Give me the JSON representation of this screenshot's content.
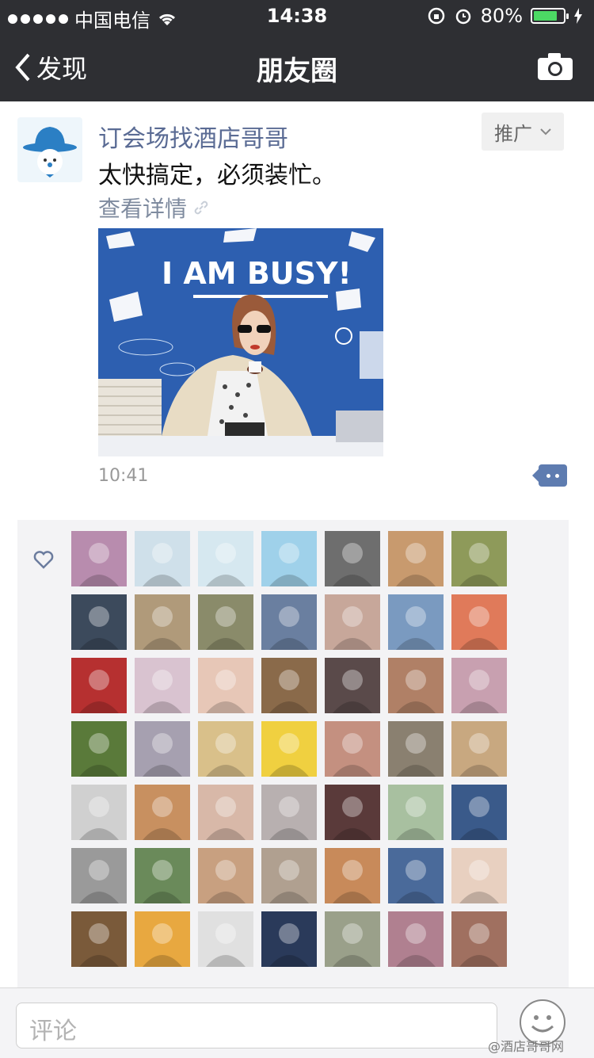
{
  "status_bar": {
    "carrier": "中国电信",
    "time": "14:38",
    "battery_pct_text": "80%",
    "battery_level": 0.8
  },
  "nav": {
    "back_label": "发现",
    "title": "朋友圈"
  },
  "post": {
    "author": "订会场找酒店哥哥",
    "promo_label": "推广",
    "text": "太快搞定，必须装忙。",
    "detail_link": "查看详情",
    "image_headline": "I AM BUSY!",
    "time": "10:41"
  },
  "likes": {
    "avatar_colors": [
      "#b88cae",
      "#cfe0ea",
      "#d6e8f0",
      "#9fd1ea",
      "#6e6e6e",
      "#c89a6e",
      "#8e9a5a",
      "#3c4a5c",
      "#b09a7a",
      "#8a8b6a",
      "#6a7fa0",
      "#c7a79a",
      "#7a9ac0",
      "#e07a5a",
      "#b63030",
      "#d9c3d0",
      "#e7c7b7",
      "#8a6a4a",
      "#5a4a4a",
      "#b08066",
      "#c8a0b0",
      "#5a7a3a",
      "#a6a0b0",
      "#d9c08a",
      "#f0d040",
      "#c49080",
      "#8a8070",
      "#c8a880",
      "#d0d0d0",
      "#c89060",
      "#d8b8a8",
      "#b8b0b0",
      "#5a3a3a",
      "#a8c0a0",
      "#3a5a8a",
      "#9a9a9a",
      "#6a8a5a",
      "#c8a080",
      "#b0a090",
      "#c88a5a",
      "#4a6a9a",
      "#e8d0c0",
      "#7a5a3a",
      "#e8a840",
      "#e0e0e0",
      "#2a3a5a",
      "#9aa08a",
      "#b08090",
      "#a07060"
    ]
  },
  "comment_bar": {
    "placeholder": "评论",
    "watermark": "@酒店哥哥网"
  }
}
